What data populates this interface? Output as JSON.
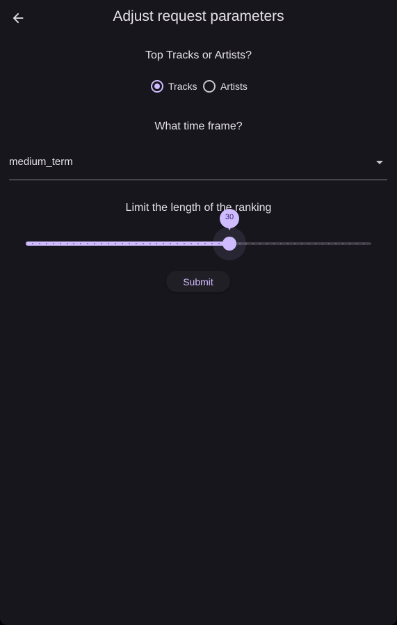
{
  "colors": {
    "background": "#17161c",
    "accent": "#cfbcff",
    "text": "#e6e1e9",
    "track_inactive": "#3f3c45"
  },
  "appbar": {
    "title": "Adjust request parameters",
    "back_icon": "arrow-left-icon"
  },
  "type_selector": {
    "question": "Top Tracks or Artists?",
    "options": [
      {
        "label": "Tracks",
        "selected": true
      },
      {
        "label": "Artists",
        "selected": false
      }
    ]
  },
  "time_frame": {
    "question": "What time frame?",
    "selected_value": "medium_term",
    "icon": "dropdown-arrow-icon"
  },
  "limit": {
    "question": "Limit the length of the ranking",
    "value": "30",
    "value_fraction": 0.59
  },
  "submit_label": "Submit"
}
